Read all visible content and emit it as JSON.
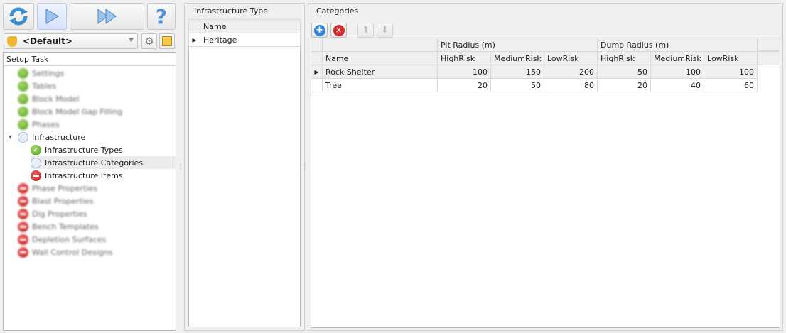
{
  "toolbar": {
    "refresh": "refresh",
    "run": "run",
    "run_all": "run-all",
    "help": "?"
  },
  "profile": {
    "selected": "<Default>"
  },
  "setup_task": {
    "header": "Setup Task",
    "items": [
      {
        "label": "Settings",
        "status": "complete",
        "blurred": true
      },
      {
        "label": "Tables",
        "status": "complete",
        "blurred": true
      },
      {
        "label": "Block Model",
        "status": "complete",
        "blurred": true
      },
      {
        "label": "Block Model Gap Filling",
        "status": "complete",
        "blurred": true
      },
      {
        "label": "Phases",
        "status": "complete",
        "blurred": true
      },
      {
        "label": "Infrastructure",
        "status": "pending",
        "expanded": true
      },
      {
        "label": "Infrastructure Types",
        "status": "done",
        "child": true
      },
      {
        "label": "Infrastructure Categories",
        "status": "pending",
        "child": true,
        "selected": true
      },
      {
        "label": "Infrastructure Items",
        "status": "blocked",
        "child": true
      },
      {
        "label": "Phase Properties",
        "status": "blocked",
        "blurred": true
      },
      {
        "label": "Blast Properties",
        "status": "blocked",
        "blurred": true
      },
      {
        "label": "Dig Properties",
        "status": "blocked",
        "blurred": true
      },
      {
        "label": "Bench Templates",
        "status": "blocked",
        "blurred": true
      },
      {
        "label": "Depletion Surfaces",
        "status": "blocked",
        "blurred": true
      },
      {
        "label": "Wall Control Designs",
        "status": "blocked",
        "blurred": true
      }
    ]
  },
  "infra_type": {
    "title": "Infrastructure Type",
    "column": "Name",
    "rows": [
      "Heritage"
    ]
  },
  "categories": {
    "title": "Categories",
    "bands": [
      "Pit Radius (m)",
      "Dump Radius (m)"
    ],
    "columns": [
      "Name",
      "HighRisk",
      "MediumRisk",
      "LowRisk",
      "HighRisk",
      "MediumRisk",
      "LowRisk"
    ],
    "rows": [
      [
        "Rock Shelter",
        "100",
        "150",
        "200",
        "50",
        "100",
        "100"
      ],
      [
        "Tree",
        "20",
        "50",
        "80",
        "20",
        "40",
        "60"
      ]
    ]
  }
}
